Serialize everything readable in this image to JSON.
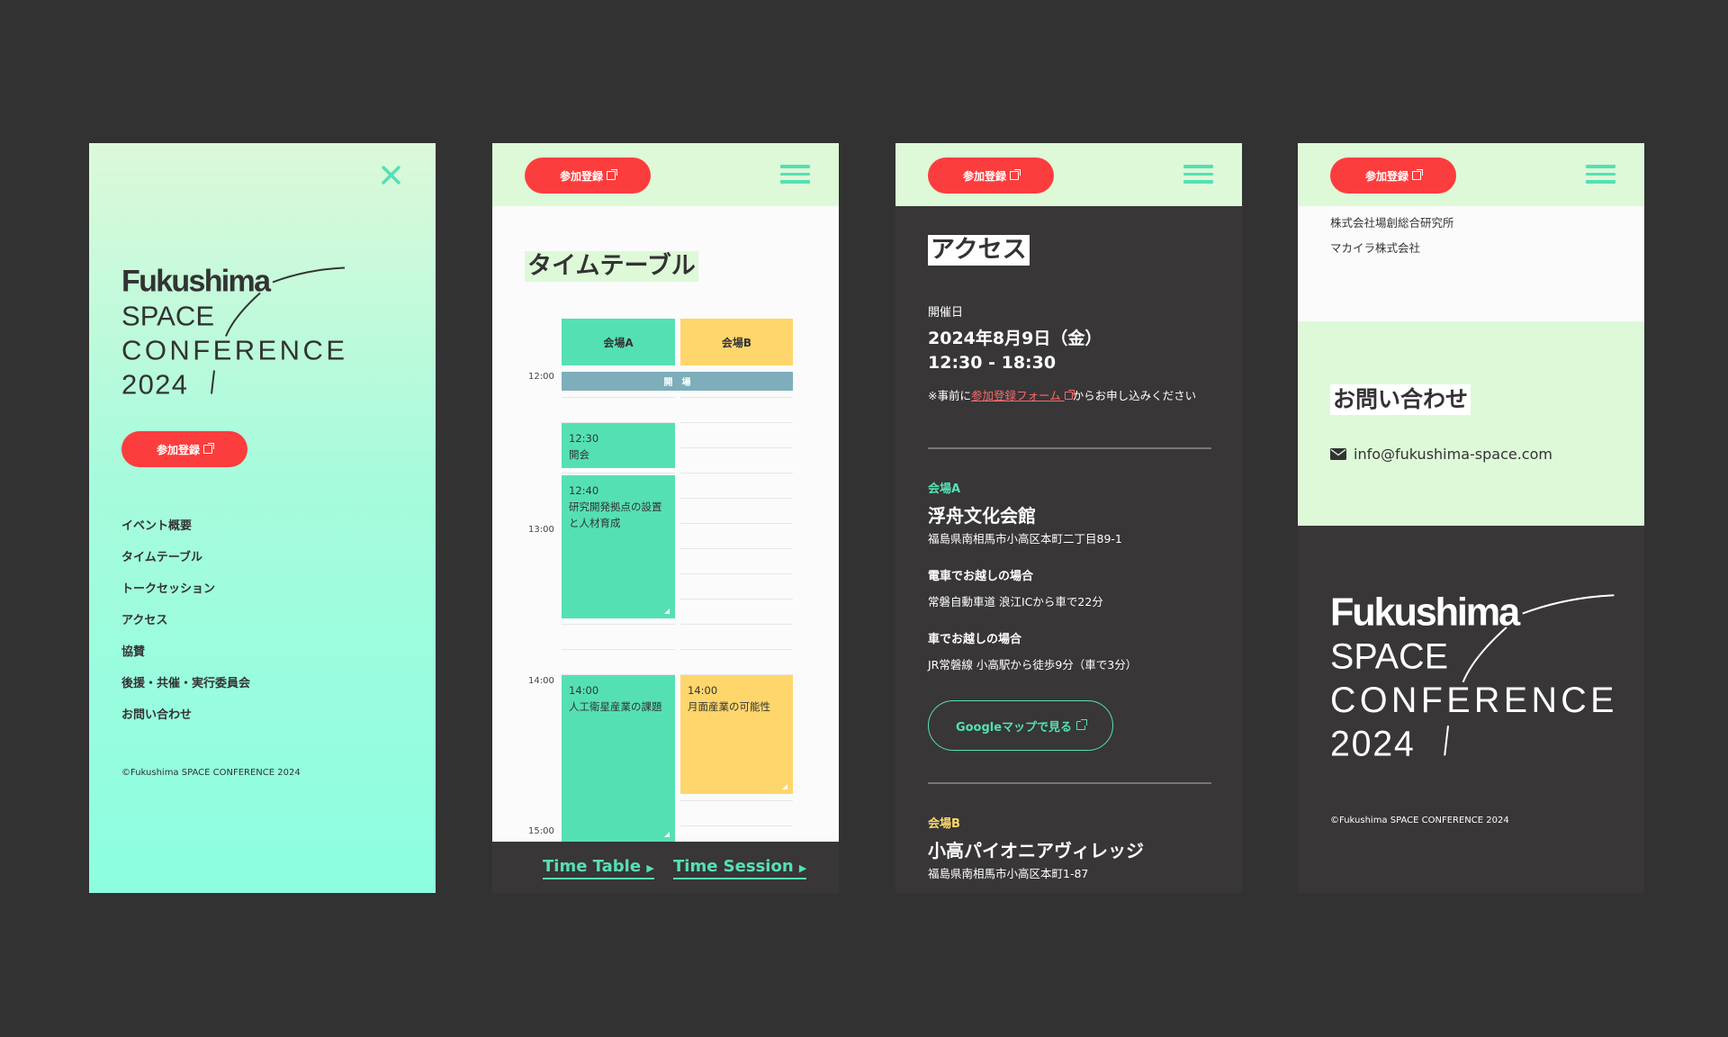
{
  "brand": {
    "logo_line1": "Fukushima",
    "logo_line2": "SPACE",
    "logo_line3": "CONFERENCE",
    "logo_line4": "2024",
    "copyright": "©Fukushima SPACE CONFERENCE 2024"
  },
  "colors": {
    "accent_green": "#55e0b4",
    "venue_b_yellow": "#ffd66b",
    "register_red": "#fc3d3d",
    "header_bg": "#ddf9d8",
    "dark_bg": "#383637",
    "opening_bar": "#7eaebb"
  },
  "header": {
    "register_label": "参加登録",
    "register_icon": "external-link-icon",
    "menu_icon": "hamburger-icon"
  },
  "menu": {
    "close_icon": "close-icon",
    "items": [
      "イベント概要",
      "タイムテーブル",
      "トークセッション",
      "アクセス",
      "協賛",
      "後援・共催・実行委員会",
      "お問い合わせ"
    ]
  },
  "timetable": {
    "title": "タイムテーブル",
    "venues": [
      "会場A",
      "会場B"
    ],
    "times": [
      "12:00",
      "13:00",
      "14:00",
      "15:00"
    ],
    "opening": "開　場",
    "sessions": [
      {
        "venue": "会場A",
        "time": "12:30",
        "title": "開会"
      },
      {
        "venue": "会場A",
        "time": "12:40",
        "title": "研究開発拠点の設置と人材育成"
      },
      {
        "venue": "会場A",
        "time": "14:00",
        "title": "人工衛星産業の課題"
      },
      {
        "venue": "会場B",
        "time": "14:00",
        "title": "月面産業の可能性"
      }
    ],
    "footer_links": [
      "Time Table",
      "Time Session"
    ]
  },
  "access": {
    "title": "アクセス",
    "date_label": "開催日",
    "date": "2024年8月9日（金）",
    "time": "12:30 - 18:30",
    "note_prefix": "※事前に",
    "note_link": "参加登録フォーム",
    "note_suffix": "からお申し込みください",
    "venue_a": {
      "label": "会場A",
      "name": "浮舟文化会館",
      "address": "福島県南相馬市小高区本町二丁目89-1",
      "route1_label": "電車でお越しの場合",
      "route1": "常磐自動車道 浪江ICから車で22分",
      "route2_label": "車でお越しの場合",
      "route2": "JR常磐線 小高駅から徒歩9分（車で3分）",
      "map_button": "Googleマップで見る"
    },
    "venue_b": {
      "label": "会場B",
      "name": "小高パイオニアヴィレッジ",
      "address": "福島県南相馬市小高区本町1-87"
    }
  },
  "contact": {
    "companies": [
      "株式会社場創総合研究所",
      "マカイラ株式会社"
    ],
    "title": "お問い合わせ",
    "email": "info@fukushima-space.com",
    "email_icon": "envelope-icon"
  }
}
